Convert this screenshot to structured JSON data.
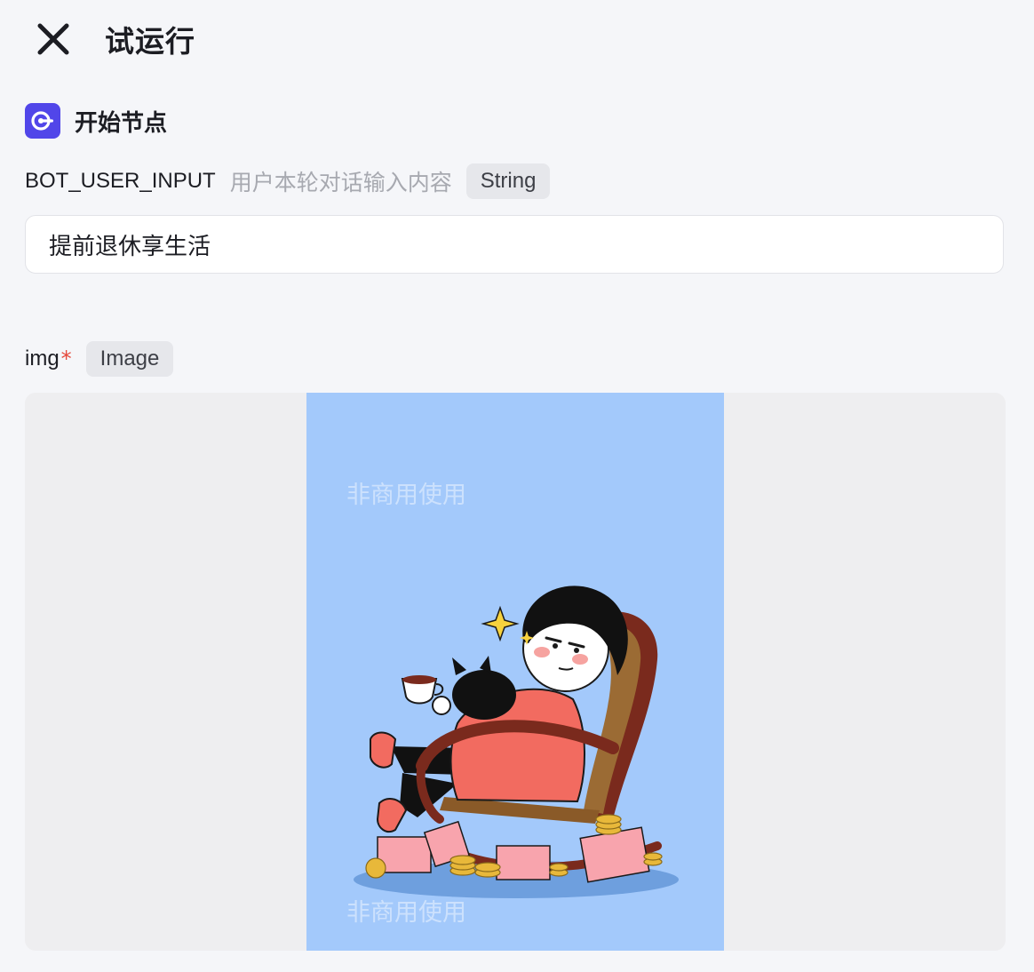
{
  "header": {
    "title": "试运行",
    "close_icon": "close-icon"
  },
  "node": {
    "icon": "start-node-icon",
    "icon_color": "#5146e9",
    "title": "开始节点"
  },
  "fields": [
    {
      "name": "BOT_USER_INPUT",
      "description": "用户本轮对话输入内容",
      "type": "String",
      "value": "提前退休享生活"
    },
    {
      "name": "img",
      "required_mark": "*",
      "type": "Image",
      "watermark": "非商用使用"
    }
  ],
  "colors": {
    "page_bg": "#f5f6f9",
    "accent": "#5146e9",
    "required": "#e5483b",
    "image_bg": "#a3c9fb"
  }
}
